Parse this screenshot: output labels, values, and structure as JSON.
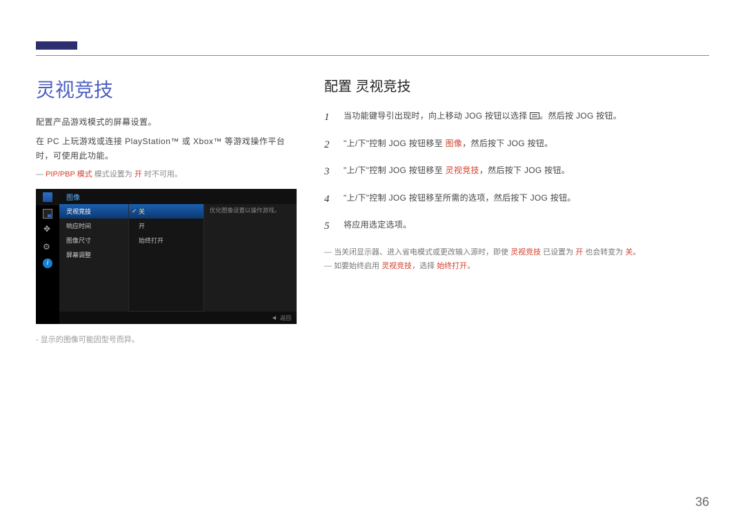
{
  "left": {
    "heading": "灵视竞技",
    "p1": "配置产品游戏模式的屏幕设置。",
    "p2": "在 PC 上玩游戏或连接 PlayStation™ 或 Xbox™ 等游戏操作平台时，可使用此功能。",
    "note_prefix": "PIP/PBP 模式",
    "note_mid": " 模式设置为 ",
    "note_on": "开",
    "note_suffix": " 时不可用。",
    "footnote": "显示的图像可能因型号而异。"
  },
  "osd": {
    "header": "图像",
    "menu": [
      "灵视竞技",
      "响应时间",
      "图像尺寸",
      "屏幕调整"
    ],
    "sub": [
      "关",
      "开",
      "始终打开"
    ],
    "desc": "优化图像设置以操作游戏。",
    "back": "返回"
  },
  "right": {
    "heading": "配置 灵视竞技",
    "steps": [
      {
        "n": "1",
        "pre": "当功能键导引出现时，向上移动 JOG 按钮以选择 ",
        "icon": true,
        "post": "。然后按 JOG 按钮。"
      },
      {
        "n": "2",
        "pre": "\"上/下\"控制 JOG 按钮移至 ",
        "hl": "图像",
        "post": "，然后按下 JOG 按钮。"
      },
      {
        "n": "3",
        "pre": "\"上/下\"控制 JOG 按钮移至 ",
        "hl": "灵视竞技",
        "post": "，然后按下 JOG 按钮。"
      },
      {
        "n": "4",
        "pre": "\"上/下\"控制 JOG 按钮移至所需的选项，然后按下 JOG 按钮。"
      },
      {
        "n": "5",
        "pre": "将应用选定选项。"
      }
    ],
    "note1_a": "当关闭显示器、进入省电模式或更改输入源时，即使 ",
    "note1_b": "灵视竞技",
    "note1_c": " 已设置为 ",
    "note1_d": "开",
    "note1_e": " 也会转变为 ",
    "note1_f": "关",
    "note1_g": "。",
    "note2_a": "如要始终启用 ",
    "note2_b": "灵视竞技",
    "note2_c": "，选择 ",
    "note2_d": "始终打开",
    "note2_e": "。"
  },
  "page_number": "36"
}
